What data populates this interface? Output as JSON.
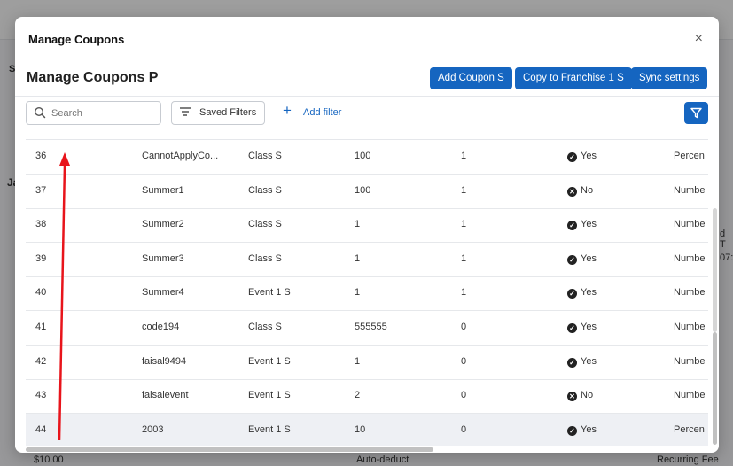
{
  "background": {
    "left_frag_1": "S",
    "left_frag_2": "Ja",
    "right_frag_1": "d T",
    "right_frag_2": "07:",
    "bottom_left": "$10.00",
    "bottom_mid": "Auto-deduct",
    "bottom_right": "Recurring Fee"
  },
  "modal": {
    "title": "Manage Coupons",
    "close": "×",
    "subtitle": "Manage Coupons P",
    "buttons": {
      "add_coupon": "Add Coupon S",
      "copy_franchise": "Copy to Franchise 1 S",
      "sync": "Sync settings"
    },
    "search_placeholder": "Search",
    "saved_filters": "Saved Filters",
    "add_filter": "Add filter"
  },
  "rows": [
    {
      "id": "36",
      "code": "CannotApplyCo...",
      "type": "Class S",
      "value": "100",
      "qty": "1",
      "active": "Yes",
      "active_icon": "check",
      "kind": "Percen"
    },
    {
      "id": "37",
      "code": "Summer1",
      "type": "Class S",
      "value": "100",
      "qty": "1",
      "active": "No",
      "active_icon": "x",
      "kind": "Numbe"
    },
    {
      "id": "38",
      "code": "Summer2",
      "type": "Class S",
      "value": "1",
      "qty": "1",
      "active": "Yes",
      "active_icon": "check",
      "kind": "Numbe"
    },
    {
      "id": "39",
      "code": "Summer3",
      "type": "Class S",
      "value": "1",
      "qty": "1",
      "active": "Yes",
      "active_icon": "check",
      "kind": "Numbe"
    },
    {
      "id": "40",
      "code": "Summer4",
      "type": "Event 1 S",
      "value": "1",
      "qty": "1",
      "active": "Yes",
      "active_icon": "check",
      "kind": "Numbe"
    },
    {
      "id": "41",
      "code": "code194",
      "type": "Class S",
      "value": "555555",
      "qty": "0",
      "active": "Yes",
      "active_icon": "check",
      "kind": "Numbe"
    },
    {
      "id": "42",
      "code": "faisal9494",
      "type": "Event 1 S",
      "value": "1",
      "qty": "0",
      "active": "Yes",
      "active_icon": "check",
      "kind": "Numbe"
    },
    {
      "id": "43",
      "code": "faisalevent",
      "type": "Event 1 S",
      "value": "2",
      "qty": "0",
      "active": "No",
      "active_icon": "x",
      "kind": "Numbe"
    },
    {
      "id": "44",
      "code": "2003",
      "type": "Event 1 S",
      "value": "10",
      "qty": "0",
      "active": "Yes",
      "active_icon": "check",
      "kind": "Percen"
    }
  ],
  "colors": {
    "primary": "#1565c0",
    "annotation_arrow": "#e8141b"
  }
}
